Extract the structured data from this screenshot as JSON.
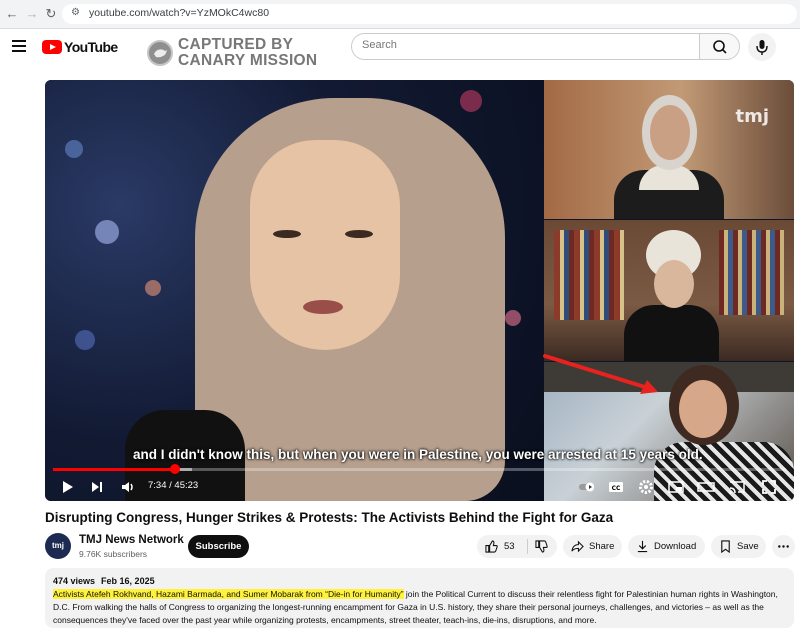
{
  "browser": {
    "back_icon": "arrow-left-icon",
    "forward_icon": "arrow-right-icon",
    "reload_icon": "reload-icon",
    "url": "youtube.com/watch?v=YzMOkC4wc80"
  },
  "header": {
    "logo_text": "YouTube",
    "watermark_line1": "CAPTURED BY",
    "watermark_line2": "CANARY MISSION",
    "search_placeholder": "Search"
  },
  "player": {
    "caption": "and I didn't know this, but when you were in Palestine, you were arrested at 15 years old.",
    "current_time": "7:34",
    "duration": "45:23",
    "time_display": "7:34 / 45:23",
    "progress_fraction": 0.1667,
    "buffered_fraction": 0.19,
    "watermark": "tmj",
    "accent": "#ff0000"
  },
  "video": {
    "title": "Disrupting Congress, Hunger Strikes & Protests: The Activists Behind the Fight for Gaza"
  },
  "channel": {
    "avatar_text": "tmj",
    "name": "TMJ News Network",
    "subscribers": "9.76K subscribers",
    "subscribe_label": "Subscribe"
  },
  "actions": {
    "like_count": "53",
    "share_label": "Share",
    "download_label": "Download",
    "save_label": "Save"
  },
  "description": {
    "views": "474 views",
    "date": "Feb 16, 2025",
    "highlighted": "Activists Atefeh Rokhvand, Hazami Barmada, and Sumer Mobarak from “Die-in for Humanity”",
    "body": " join the Political Current to discuss their relentless fight for Palestinian human rights in Washington, D.C. From walking the halls of Congress to organizing the longest-running encampment for Gaza in U.S. history, they share their personal journeys, challenges, and victories – as well as the consequences they've faced over the past year while organizing protests, encampments, street theater, teach-ins, die-ins, disruptions, and more."
  }
}
